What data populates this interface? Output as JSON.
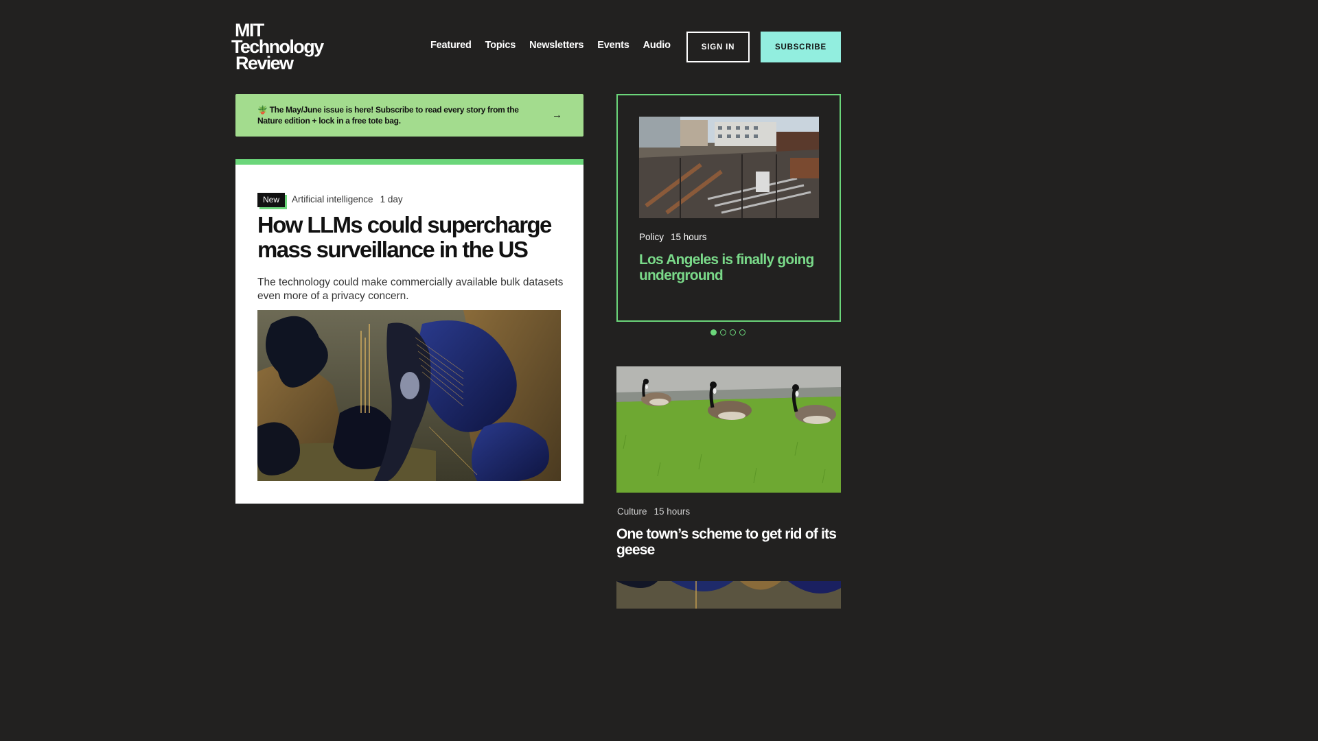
{
  "header": {
    "logo_lines": [
      "MIT",
      "Technology",
      "Review"
    ],
    "nav": [
      "Featured",
      "Topics",
      "Newsletters",
      "Events",
      "Audio"
    ],
    "sign_in": "SIGN IN",
    "subscribe": "SUBSCRIBE"
  },
  "promo": {
    "icon": "plant-icon",
    "text": "The May/June issue is here! Subscribe to read every story from the Nature edition + lock in a free tote bag.",
    "arrow": "→"
  },
  "main_story": {
    "badge": "New",
    "category": "Artificial intelligence",
    "age": "1 day",
    "title": "How LLMs could supercharge mass surveillance in the US",
    "subtitle": "The technology could make commercially available bulk datasets even more of a privacy concern."
  },
  "carousel": {
    "category": "Policy",
    "age": "15 hours",
    "title": "Los Angeles is finally going underground",
    "slide_count": 4,
    "active_slide": 1
  },
  "side_story": {
    "category": "Culture",
    "age": "15 hours",
    "title": "One town’s scheme to get rid of its geese"
  },
  "colors": {
    "background": "#222120",
    "accent_green": "#6bd67a",
    "promo_green": "#a3dc8e",
    "subscribe_teal": "#92eedf"
  }
}
